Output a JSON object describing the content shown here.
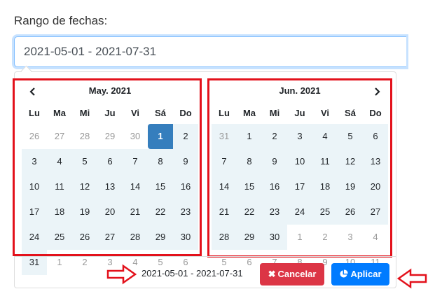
{
  "form": {
    "label": "Rango de fechas:",
    "range_value": "2021-05-01 - 2021-07-31"
  },
  "calendars": [
    {
      "month": "May. 2021",
      "weekdays": [
        "Lu",
        "Ma",
        "Mi",
        "Ju",
        "Vi",
        "Sá",
        "Do"
      ],
      "days": [
        {
          "d": "26",
          "off": true,
          "inrange": false
        },
        {
          "d": "27",
          "off": true,
          "inrange": false
        },
        {
          "d": "28",
          "off": true,
          "inrange": false
        },
        {
          "d": "29",
          "off": true,
          "inrange": false
        },
        {
          "d": "30",
          "off": true,
          "inrange": false
        },
        {
          "d": "1",
          "off": false,
          "inrange": true,
          "active": true
        },
        {
          "d": "2",
          "off": false,
          "inrange": true
        },
        {
          "d": "3",
          "inrange": true
        },
        {
          "d": "4",
          "inrange": true
        },
        {
          "d": "5",
          "inrange": true
        },
        {
          "d": "6",
          "inrange": true
        },
        {
          "d": "7",
          "inrange": true
        },
        {
          "d": "8",
          "inrange": true
        },
        {
          "d": "9",
          "inrange": true
        },
        {
          "d": "10",
          "inrange": true
        },
        {
          "d": "11",
          "inrange": true
        },
        {
          "d": "12",
          "inrange": true
        },
        {
          "d": "13",
          "inrange": true
        },
        {
          "d": "14",
          "inrange": true
        },
        {
          "d": "15",
          "inrange": true
        },
        {
          "d": "16",
          "inrange": true
        },
        {
          "d": "17",
          "inrange": true
        },
        {
          "d": "18",
          "inrange": true
        },
        {
          "d": "19",
          "inrange": true
        },
        {
          "d": "20",
          "inrange": true
        },
        {
          "d": "21",
          "inrange": true
        },
        {
          "d": "22",
          "inrange": true
        },
        {
          "d": "23",
          "inrange": true
        },
        {
          "d": "24",
          "inrange": true
        },
        {
          "d": "25",
          "inrange": true
        },
        {
          "d": "26",
          "inrange": true
        },
        {
          "d": "27",
          "inrange": true
        },
        {
          "d": "28",
          "inrange": true
        },
        {
          "d": "29",
          "inrange": true
        },
        {
          "d": "30",
          "inrange": true
        },
        {
          "d": "31",
          "inrange": true
        },
        {
          "d": "1",
          "off": true
        },
        {
          "d": "2",
          "off": true
        },
        {
          "d": "3",
          "off": true
        },
        {
          "d": "4",
          "off": true
        },
        {
          "d": "5",
          "off": true
        },
        {
          "d": "6",
          "off": true
        }
      ]
    },
    {
      "month": "Jun. 2021",
      "weekdays": [
        "Lu",
        "Ma",
        "Mi",
        "Ju",
        "Vi",
        "Sá",
        "Do"
      ],
      "days": [
        {
          "d": "31",
          "off": true,
          "inrange": true
        },
        {
          "d": "1",
          "inrange": true
        },
        {
          "d": "2",
          "inrange": true
        },
        {
          "d": "3",
          "inrange": true
        },
        {
          "d": "4",
          "inrange": true
        },
        {
          "d": "5",
          "inrange": true
        },
        {
          "d": "6",
          "inrange": true
        },
        {
          "d": "7",
          "inrange": true
        },
        {
          "d": "8",
          "inrange": true
        },
        {
          "d": "9",
          "inrange": true
        },
        {
          "d": "10",
          "inrange": true
        },
        {
          "d": "11",
          "inrange": true
        },
        {
          "d": "12",
          "inrange": true
        },
        {
          "d": "13",
          "inrange": true
        },
        {
          "d": "14",
          "inrange": true
        },
        {
          "d": "15",
          "inrange": true
        },
        {
          "d": "16",
          "inrange": true
        },
        {
          "d": "17",
          "inrange": true
        },
        {
          "d": "18",
          "inrange": true
        },
        {
          "d": "19",
          "inrange": true
        },
        {
          "d": "20",
          "inrange": true
        },
        {
          "d": "21",
          "inrange": true
        },
        {
          "d": "22",
          "inrange": true
        },
        {
          "d": "23",
          "inrange": true
        },
        {
          "d": "24",
          "inrange": true
        },
        {
          "d": "25",
          "inrange": true
        },
        {
          "d": "26",
          "inrange": true
        },
        {
          "d": "27",
          "inrange": true
        },
        {
          "d": "28",
          "inrange": true
        },
        {
          "d": "29",
          "inrange": true
        },
        {
          "d": "30",
          "inrange": true
        },
        {
          "d": "1",
          "off": true
        },
        {
          "d": "2",
          "off": true
        },
        {
          "d": "3",
          "off": true
        },
        {
          "d": "4",
          "off": true
        },
        {
          "d": "5",
          "off": true
        },
        {
          "d": "6",
          "off": true
        },
        {
          "d": "7",
          "off": true
        },
        {
          "d": "8",
          "off": true
        },
        {
          "d": "9",
          "off": true
        },
        {
          "d": "10",
          "off": true
        },
        {
          "d": "11",
          "off": true
        }
      ]
    }
  ],
  "nav": {
    "prev_icon": "chevron-left-icon",
    "next_icon": "chevron-right-icon"
  },
  "footer": {
    "selected_range": "2021-05-01 - 2021-07-31",
    "cancel_label": "Cancelar",
    "apply_label": "Aplicar",
    "cancel_icon": "times-icon",
    "apply_icon": "chart-pie-icon"
  },
  "colors": {
    "active_day": "#357ebd",
    "in_range": "#ebf4f8",
    "cancel": "#dc3545",
    "apply": "#007bff",
    "annotation": "#e3111b"
  }
}
